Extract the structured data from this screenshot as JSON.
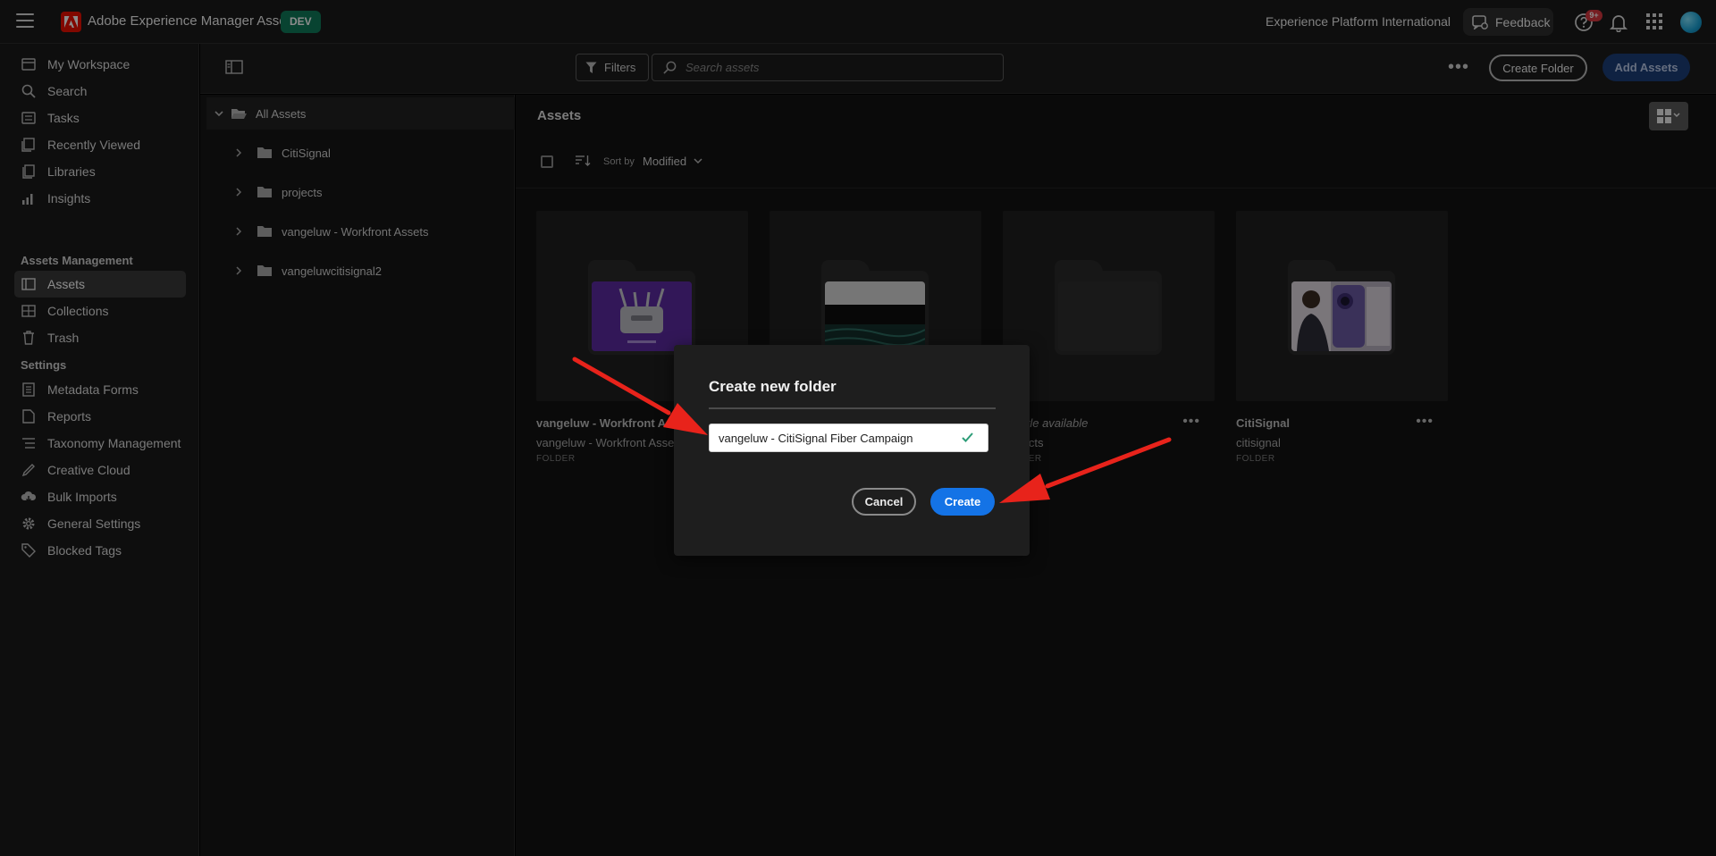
{
  "header": {
    "app_title": "Adobe Experience Manager Assets",
    "env_badge": "DEV",
    "org_name": "Experience Platform International",
    "feedback_label": "Feedback",
    "notification_count": "9+",
    "icons": [
      "hamburger-icon",
      "adobe-logo",
      "feedback-icon",
      "help-icon",
      "bell-icon",
      "app-switcher-icon",
      "avatar"
    ]
  },
  "sidebar": {
    "items": [
      {
        "label": "My Workspace",
        "icon": "workspace-icon"
      },
      {
        "label": "Search",
        "icon": "search-icon"
      },
      {
        "label": "Tasks",
        "icon": "tasks-icon"
      },
      {
        "label": "Recently Viewed",
        "icon": "recent-icon"
      },
      {
        "label": "Libraries",
        "icon": "libraries-icon"
      },
      {
        "label": "Insights",
        "icon": "insights-icon"
      }
    ],
    "section_assets": "Assets Management",
    "assets_items": [
      {
        "label": "Assets",
        "icon": "assets-icon",
        "active": true
      },
      {
        "label": "Collections",
        "icon": "collections-icon"
      },
      {
        "label": "Trash",
        "icon": "trash-icon"
      }
    ],
    "section_settings": "Settings",
    "settings_items": [
      {
        "label": "Metadata Forms",
        "icon": "metadata-icon"
      },
      {
        "label": "Reports",
        "icon": "reports-icon"
      },
      {
        "label": "Taxonomy Management",
        "icon": "taxonomy-icon"
      },
      {
        "label": "Creative Cloud",
        "icon": "creative-cloud-icon"
      },
      {
        "label": "Bulk Imports",
        "icon": "bulk-import-icon"
      },
      {
        "label": "General Settings",
        "icon": "gear-icon"
      },
      {
        "label": "Blocked Tags",
        "icon": "tag-icon"
      }
    ]
  },
  "toolbar": {
    "filters_label": "Filters",
    "search_placeholder": "Search assets",
    "create_folder_label": "Create Folder",
    "add_assets_label": "Add Assets"
  },
  "tree": {
    "root_label": "All Assets",
    "items": [
      "CitiSignal",
      "projects",
      "vangeluw - Workfront Assets",
      "vangeluwcitisignal2"
    ]
  },
  "content": {
    "title": "Assets",
    "sort_by_label": "Sort by",
    "sort_value": "Modified",
    "cards": [
      {
        "name": "vangeluw - Workfront Assets",
        "sub": "vangeluw - Workfront Assets",
        "type": "FOLDER",
        "thumb": "citisignal-router"
      },
      {
        "name": "",
        "sub": "",
        "type": "",
        "thumb": "fiber-image"
      },
      {
        "name": "No title available",
        "sub": "projects",
        "type": "FOLDER",
        "thumb": "empty"
      },
      {
        "name": "CitiSignal",
        "sub": "citisignal",
        "type": "FOLDER",
        "thumb": "person-phone"
      }
    ]
  },
  "dialog": {
    "title": "Create new folder",
    "input_value": "vangeluw - CitiSignal Fiber Campaign",
    "cancel_label": "Cancel",
    "create_label": "Create"
  },
  "colors": {
    "accent": "#1473e6",
    "brand_red": "#eb1000",
    "env_badge": "#0f7a5a",
    "annotation_arrow": "#e8231b"
  }
}
